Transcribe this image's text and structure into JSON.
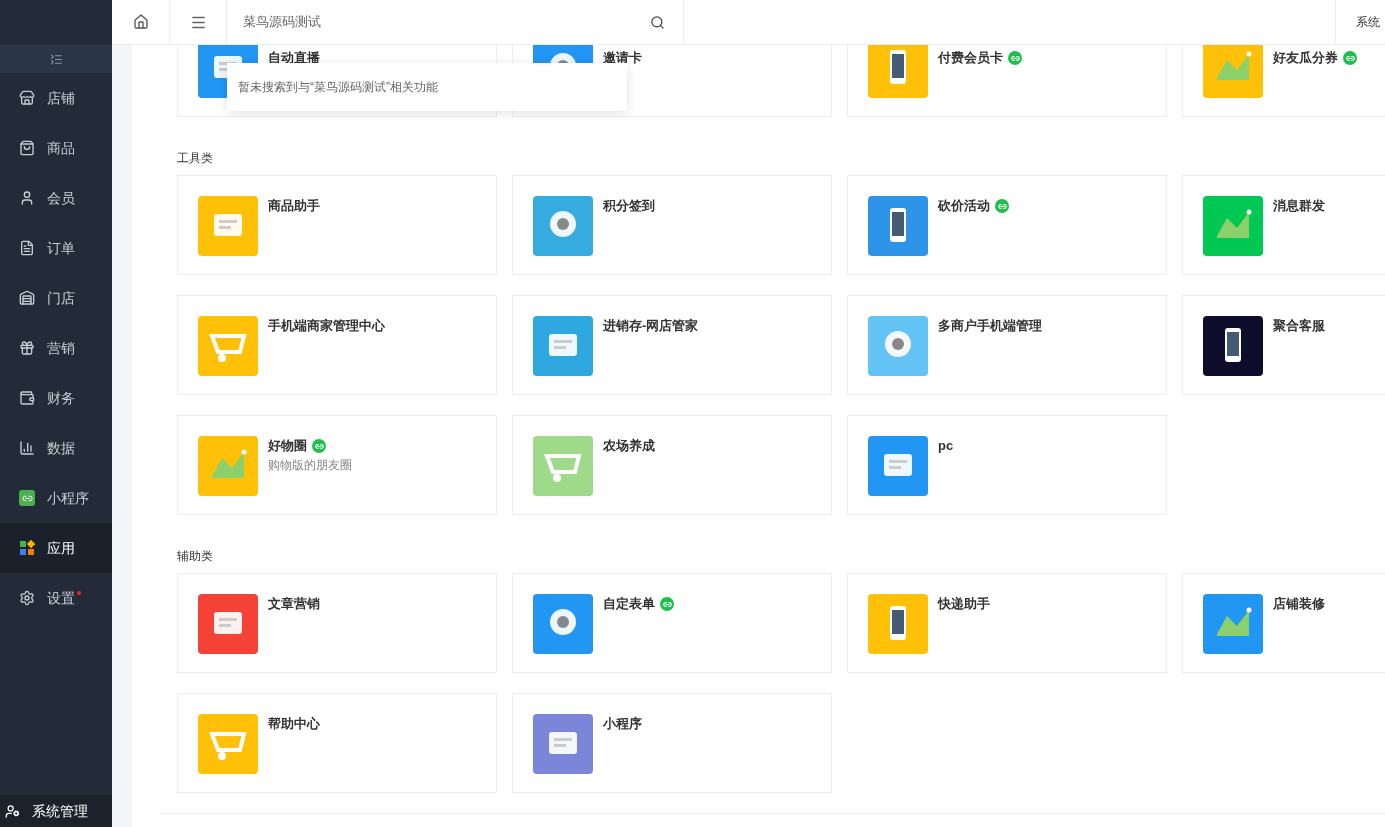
{
  "sidebar": {
    "items": [
      {
        "label": "店铺",
        "selected": false,
        "dot": false
      },
      {
        "label": "商品",
        "selected": false,
        "dot": false
      },
      {
        "label": "会员",
        "selected": false,
        "dot": false
      },
      {
        "label": "订单",
        "selected": false,
        "dot": false
      },
      {
        "label": "门店",
        "selected": false,
        "dot": false
      },
      {
        "label": "营销",
        "selected": false,
        "dot": false
      },
      {
        "label": "财务",
        "selected": false,
        "dot": false
      },
      {
        "label": "数据",
        "selected": false,
        "dot": false
      },
      {
        "label": "小程序",
        "selected": false,
        "dot": false
      },
      {
        "label": "应用",
        "selected": true,
        "dot": false
      },
      {
        "label": "设置",
        "selected": false,
        "dot": true
      }
    ],
    "footer": "系统管理"
  },
  "header": {
    "search": {
      "value": "菜鸟源码测试"
    },
    "account": "系统"
  },
  "search_dropdown": {
    "message": "暂未搜索到与“菜鸟源码测试”相关功能"
  },
  "sections": [
    {
      "items": [
        {
          "name": "自动直播",
          "mini_program": false,
          "color": "#2196f3"
        },
        {
          "name": "邀请卡",
          "mini_program": false,
          "color": "#2196f3"
        },
        {
          "name": "付费会员卡",
          "mini_program": true,
          "color": "#ffc107"
        },
        {
          "name": "好友瓜分券",
          "mini_program": true,
          "color": "#ffc107"
        }
      ]
    },
    {
      "title": "工具类",
      "items": [
        {
          "name": "商品助手",
          "mini_program": false,
          "color": "#ffc107"
        },
        {
          "name": "积分签到",
          "mini_program": false,
          "color": "#36abe0"
        },
        {
          "name": "砍价活动",
          "mini_program": true,
          "color": "#2d94e8"
        },
        {
          "name": "消息群发",
          "mini_program": false,
          "color": "#00c853"
        },
        {
          "name": "手机端商家管理中心",
          "mini_program": false,
          "color": "#ffc107"
        },
        {
          "name": "进销存-网店管家",
          "mini_program": false,
          "color": "#2fa8e0"
        },
        {
          "name": "多商户手机端管理",
          "mini_program": false,
          "color": "#64c3f5"
        },
        {
          "name": "聚合客服",
          "mini_program": false,
          "color": "#0d0d2b"
        },
        {
          "name": "好物圈",
          "mini_program": true,
          "subtitle": "购物版的朋友圈",
          "color": "#ffc107"
        },
        {
          "name": "农场养成",
          "mini_program": false,
          "color": "#9fd98a"
        },
        {
          "name": "pc",
          "mini_program": false,
          "color": "#2196f3"
        }
      ]
    },
    {
      "title": "辅助类",
      "items": [
        {
          "name": "文章营销",
          "mini_program": false,
          "color": "#f44336"
        },
        {
          "name": "自定表单",
          "mini_program": true,
          "color": "#2196f3"
        },
        {
          "name": "快递助手",
          "mini_program": false,
          "color": "#ffc107"
        },
        {
          "name": "店铺装修",
          "mini_program": false,
          "color": "#2196f3"
        },
        {
          "name": "帮助中心",
          "mini_program": false,
          "color": "#ffc107"
        },
        {
          "name": "小程序",
          "mini_program": false,
          "color": "#7b86d8"
        }
      ]
    }
  ]
}
